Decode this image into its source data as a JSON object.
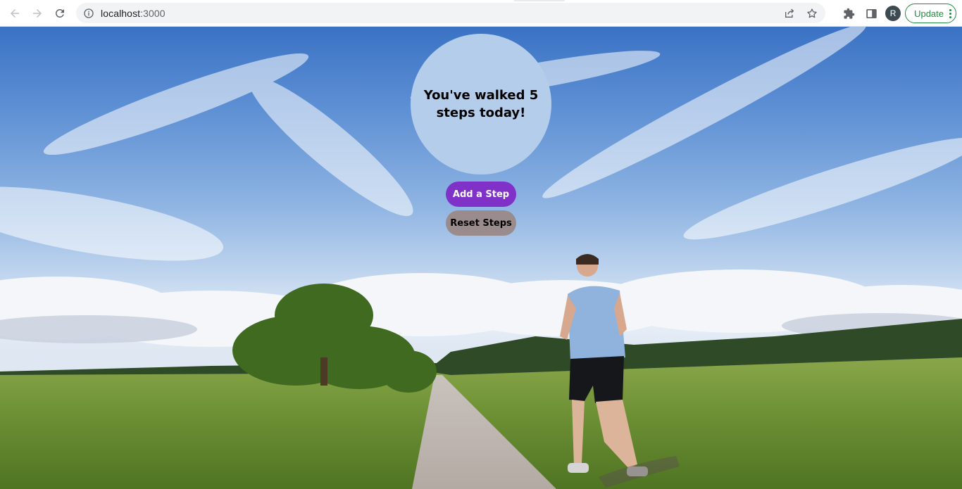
{
  "browser": {
    "url_host": "localhost",
    "url_port": ":3000",
    "avatar_letter": "R",
    "update_label": "Update"
  },
  "app": {
    "message": "You've walked 5 steps today!",
    "step_count": 5,
    "add_button_label": "Add a Step",
    "reset_button_label": "Reset Steps"
  },
  "colors": {
    "circle": "#b3cdeb",
    "add_button": "#8032c8",
    "reset_button": "#9a8c8c",
    "update_accent": "#1e8e3e"
  },
  "icons": [
    "back-icon",
    "forward-icon",
    "reload-icon",
    "site-info-icon",
    "share-icon",
    "bookmark-star-icon",
    "extensions-icon",
    "side-panel-icon",
    "menu-kebab-icon"
  ]
}
